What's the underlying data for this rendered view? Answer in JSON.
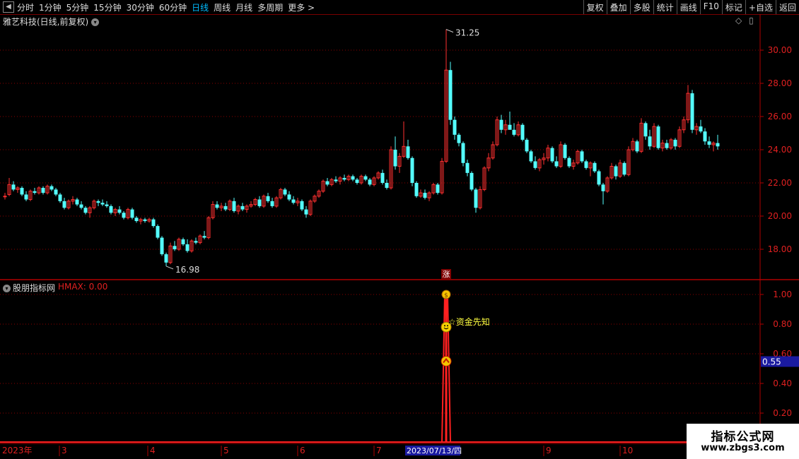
{
  "toolbar": {
    "timeframes": [
      "分时",
      "1分钟",
      "5分钟",
      "15分钟",
      "30分钟",
      "60分钟",
      "日线",
      "周线",
      "月线",
      "多周期",
      "更多"
    ],
    "active": "日线",
    "right_buttons": [
      "复权",
      "叠加",
      "多股",
      "统计",
      "画线",
      "F10",
      "标记",
      "+自选",
      "返回"
    ]
  },
  "main": {
    "title": "雅艺科技(日线,前复权)",
    "price_max_label": "31.25",
    "price_min_label": "16.98",
    "y_ticks": [
      "30.00",
      "28.00",
      "26.00",
      "24.00",
      "22.00",
      "20.00",
      "18.00"
    ],
    "marker": "涨"
  },
  "indicator": {
    "title": "股朋指标网",
    "value_label": "HMAX: 0.00",
    "y_ticks": [
      "1.00",
      "0.80",
      "0.60",
      "0.40",
      "0.20"
    ],
    "current_value": "0.55",
    "annotation": "资金先知"
  },
  "xaxis": {
    "year": "2023年",
    "months": [
      "3",
      "4",
      "5",
      "6",
      "7",
      "9",
      "10"
    ],
    "cursor_date": "2023/07/13/四"
  },
  "watermark": {
    "line1": "指标公式网",
    "line2": "www.zbgs3.com"
  },
  "colors": {
    "up": "#ff3030",
    "down": "#54ffff",
    "grid": "#8b0000",
    "axis": "#b00000",
    "label": "#e02020"
  },
  "chart_data": {
    "type": "candlestick",
    "ylim": [
      16.2,
      32.0
    ],
    "ohlc": [
      [
        21.2,
        21.4,
        21.0,
        21.2
      ],
      [
        21.3,
        22.3,
        21.2,
        21.9
      ],
      [
        21.9,
        22.1,
        21.5,
        21.6
      ],
      [
        21.6,
        21.8,
        21.4,
        21.7
      ],
      [
        21.7,
        21.8,
        21.2,
        21.3
      ],
      [
        21.3,
        21.5,
        20.9,
        21.0
      ],
      [
        21.0,
        21.6,
        20.9,
        21.5
      ],
      [
        21.5,
        21.7,
        21.3,
        21.4
      ],
      [
        21.4,
        21.8,
        21.3,
        21.7
      ],
      [
        21.7,
        21.8,
        21.3,
        21.4
      ],
      [
        21.4,
        21.9,
        21.3,
        21.8
      ],
      [
        21.8,
        21.9,
        21.5,
        21.6
      ],
      [
        21.6,
        21.7,
        21.2,
        21.3
      ],
      [
        21.3,
        21.4,
        20.8,
        20.9
      ],
      [
        20.9,
        21.1,
        20.4,
        20.5
      ],
      [
        20.5,
        21.0,
        20.4,
        20.9
      ],
      [
        20.9,
        21.2,
        20.7,
        21.0
      ],
      [
        21.0,
        21.1,
        20.6,
        20.7
      ],
      [
        20.7,
        20.9,
        20.4,
        20.5
      ],
      [
        20.5,
        20.6,
        20.1,
        20.2
      ],
      [
        20.2,
        20.6,
        19.9,
        20.5
      ],
      [
        20.5,
        21.0,
        20.4,
        20.9
      ],
      [
        20.9,
        21.0,
        20.6,
        20.8
      ],
      [
        20.8,
        21.0,
        20.6,
        20.7
      ],
      [
        20.7,
        20.9,
        20.5,
        20.6
      ],
      [
        20.6,
        20.7,
        20.1,
        20.2
      ],
      [
        20.2,
        20.5,
        20.0,
        20.4
      ],
      [
        20.4,
        20.6,
        20.1,
        20.2
      ],
      [
        20.2,
        20.3,
        19.8,
        19.9
      ],
      [
        19.9,
        20.5,
        19.8,
        20.4
      ],
      [
        20.4,
        20.5,
        19.8,
        19.9
      ],
      [
        19.9,
        20.0,
        19.6,
        19.7
      ],
      [
        19.7,
        19.9,
        19.5,
        19.8
      ],
      [
        19.8,
        19.9,
        19.6,
        19.7
      ],
      [
        19.7,
        19.9,
        19.6,
        19.8
      ],
      [
        19.8,
        19.9,
        19.3,
        19.4
      ],
      [
        19.4,
        19.5,
        18.6,
        18.7
      ],
      [
        18.7,
        18.8,
        17.6,
        17.7
      ],
      [
        17.7,
        17.8,
        16.98,
        17.2
      ],
      [
        17.2,
        18.4,
        17.1,
        18.2
      ],
      [
        18.2,
        18.5,
        17.9,
        18.0
      ],
      [
        18.0,
        18.7,
        17.9,
        18.6
      ],
      [
        18.6,
        18.7,
        18.2,
        18.3
      ],
      [
        18.3,
        18.6,
        17.8,
        17.9
      ],
      [
        17.9,
        18.6,
        17.8,
        18.5
      ],
      [
        18.5,
        18.7,
        18.3,
        18.4
      ],
      [
        18.4,
        18.9,
        18.3,
        18.8
      ],
      [
        18.8,
        19.1,
        18.6,
        18.7
      ],
      [
        18.7,
        20.0,
        18.6,
        19.9
      ],
      [
        19.9,
        20.9,
        19.8,
        20.7
      ],
      [
        20.7,
        20.9,
        20.4,
        20.5
      ],
      [
        20.5,
        20.8,
        20.3,
        20.6
      ],
      [
        20.6,
        20.8,
        20.3,
        20.4
      ],
      [
        20.4,
        21.0,
        20.3,
        20.9
      ],
      [
        20.9,
        21.1,
        20.2,
        20.3
      ],
      [
        20.3,
        20.7,
        20.1,
        20.6
      ],
      [
        20.6,
        20.8,
        20.3,
        20.4
      ],
      [
        20.4,
        20.7,
        20.2,
        20.6
      ],
      [
        20.6,
        20.9,
        20.5,
        20.7
      ],
      [
        20.7,
        21.1,
        20.6,
        21.0
      ],
      [
        21.0,
        21.2,
        20.5,
        20.6
      ],
      [
        20.6,
        21.3,
        20.5,
        21.2
      ],
      [
        21.2,
        21.4,
        20.8,
        20.9
      ],
      [
        20.9,
        21.1,
        20.5,
        20.6
      ],
      [
        20.6,
        21.2,
        20.5,
        21.1
      ],
      [
        21.1,
        21.7,
        21.0,
        21.6
      ],
      [
        21.6,
        21.7,
        21.2,
        21.3
      ],
      [
        21.3,
        21.5,
        20.9,
        21.0
      ],
      [
        21.0,
        21.2,
        20.7,
        20.8
      ],
      [
        20.8,
        21.1,
        20.6,
        20.9
      ],
      [
        20.9,
        21.0,
        20.3,
        20.4
      ],
      [
        20.4,
        20.6,
        19.9,
        20.1
      ],
      [
        20.1,
        21.0,
        20.0,
        20.9
      ],
      [
        20.9,
        21.3,
        20.8,
        21.2
      ],
      [
        21.2,
        21.6,
        21.1,
        21.5
      ],
      [
        21.5,
        22.2,
        21.4,
        22.1
      ],
      [
        22.1,
        22.3,
        21.8,
        21.9
      ],
      [
        21.9,
        22.3,
        21.8,
        22.2
      ],
      [
        22.2,
        22.4,
        22.0,
        22.1
      ],
      [
        22.1,
        22.4,
        21.9,
        22.3
      ],
      [
        22.3,
        22.5,
        22.1,
        22.2
      ],
      [
        22.2,
        22.5,
        22.1,
        22.4
      ],
      [
        22.4,
        22.5,
        22.1,
        22.2
      ],
      [
        22.2,
        22.3,
        21.9,
        22.0
      ],
      [
        22.0,
        22.5,
        21.9,
        22.4
      ],
      [
        22.4,
        22.5,
        22.1,
        22.2
      ],
      [
        22.2,
        22.3,
        21.8,
        21.9
      ],
      [
        21.9,
        22.4,
        21.8,
        22.3
      ],
      [
        22.3,
        22.7,
        22.2,
        22.6
      ],
      [
        22.6,
        22.8,
        21.9,
        22.0
      ],
      [
        22.0,
        22.2,
        21.6,
        21.7
      ],
      [
        21.7,
        24.2,
        21.6,
        24.0
      ],
      [
        24.0,
        24.8,
        22.8,
        23.0
      ],
      [
        23.0,
        23.8,
        22.6,
        23.6
      ],
      [
        23.6,
        25.7,
        23.5,
        24.2
      ],
      [
        24.2,
        24.6,
        23.4,
        23.5
      ],
      [
        23.5,
        23.6,
        21.8,
        22.0
      ],
      [
        22.0,
        22.1,
        21.1,
        21.2
      ],
      [
        21.2,
        21.6,
        21.1,
        21.4
      ],
      [
        21.4,
        21.6,
        21.0,
        21.1
      ],
      [
        21.1,
        21.5,
        20.9,
        21.4
      ],
      [
        21.4,
        22.0,
        21.3,
        21.9
      ],
      [
        21.9,
        22.0,
        21.3,
        21.4
      ],
      [
        21.4,
        23.5,
        21.3,
        23.3
      ],
      [
        23.3,
        31.25,
        23.2,
        28.8
      ],
      [
        28.8,
        29.3,
        25.5,
        25.8
      ],
      [
        25.8,
        26.0,
        24.6,
        24.9
      ],
      [
        24.9,
        25.0,
        24.2,
        24.4
      ],
      [
        24.4,
        24.5,
        23.0,
        23.2
      ],
      [
        23.2,
        23.4,
        22.4,
        22.6
      ],
      [
        22.6,
        22.7,
        21.5,
        21.6
      ],
      [
        21.6,
        21.7,
        20.2,
        20.5
      ],
      [
        20.5,
        21.8,
        20.4,
        21.6
      ],
      [
        21.6,
        23.0,
        21.5,
        22.9
      ],
      [
        22.9,
        23.8,
        22.7,
        23.5
      ],
      [
        23.5,
        24.5,
        23.4,
        24.3
      ],
      [
        24.3,
        26.0,
        24.2,
        25.8
      ],
      [
        25.8,
        26.1,
        25.0,
        25.2
      ],
      [
        25.2,
        25.8,
        24.9,
        25.5
      ],
      [
        25.5,
        26.3,
        25.4,
        25.2
      ],
      [
        25.2,
        25.6,
        24.8,
        24.9
      ],
      [
        24.9,
        25.7,
        24.8,
        25.5
      ],
      [
        25.5,
        25.6,
        24.5,
        24.6
      ],
      [
        24.6,
        24.7,
        23.8,
        23.9
      ],
      [
        23.9,
        24.0,
        23.2,
        23.3
      ],
      [
        23.3,
        23.6,
        22.8,
        22.9
      ],
      [
        22.9,
        23.5,
        22.7,
        23.4
      ],
      [
        23.4,
        23.8,
        23.1,
        23.5
      ],
      [
        23.5,
        24.3,
        23.3,
        24.1
      ],
      [
        24.1,
        24.2,
        23.2,
        23.3
      ],
      [
        23.3,
        23.6,
        22.9,
        23.0
      ],
      [
        23.0,
        24.5,
        22.9,
        24.3
      ],
      [
        24.3,
        24.4,
        23.4,
        23.5
      ],
      [
        23.5,
        23.6,
        22.9,
        23.0
      ],
      [
        23.0,
        23.4,
        22.8,
        23.2
      ],
      [
        23.2,
        24.0,
        23.1,
        23.9
      ],
      [
        23.9,
        24.0,
        23.2,
        23.3
      ],
      [
        23.3,
        23.4,
        22.8,
        22.9
      ],
      [
        22.9,
        23.3,
        22.4,
        23.2
      ],
      [
        23.2,
        23.3,
        22.6,
        22.7
      ],
      [
        22.7,
        22.8,
        21.8,
        21.9
      ],
      [
        21.9,
        22.0,
        20.7,
        21.5
      ],
      [
        21.5,
        22.4,
        21.4,
        22.3
      ],
      [
        22.3,
        23.2,
        22.2,
        23.0
      ],
      [
        23.0,
        23.1,
        22.2,
        22.4
      ],
      [
        22.4,
        23.4,
        22.3,
        23.2
      ],
      [
        23.2,
        23.3,
        22.4,
        22.5
      ],
      [
        22.5,
        24.2,
        22.4,
        24.0
      ],
      [
        24.0,
        24.7,
        23.9,
        24.5
      ],
      [
        24.5,
        24.6,
        23.8,
        23.9
      ],
      [
        23.9,
        25.9,
        23.8,
        25.6
      ],
      [
        25.6,
        25.7,
        24.6,
        24.8
      ],
      [
        24.8,
        25.2,
        24.0,
        24.2
      ],
      [
        24.2,
        25.6,
        24.1,
        25.4
      ],
      [
        25.4,
        25.5,
        24.0,
        24.1
      ],
      [
        24.1,
        24.6,
        23.9,
        24.4
      ],
      [
        24.4,
        24.6,
        24.0,
        24.1
      ],
      [
        24.1,
        24.7,
        24.0,
        24.6
      ],
      [
        24.6,
        24.7,
        24.0,
        24.2
      ],
      [
        24.2,
        25.4,
        24.1,
        25.2
      ],
      [
        25.2,
        26.0,
        25.0,
        25.8
      ],
      [
        25.8,
        27.9,
        25.6,
        27.4
      ],
      [
        27.4,
        27.6,
        25.0,
        25.2
      ],
      [
        25.2,
        25.6,
        24.9,
        25.4
      ],
      [
        25.4,
        25.8,
        25.0,
        25.1
      ],
      [
        25.1,
        25.3,
        24.3,
        24.5
      ],
      [
        24.5,
        24.8,
        24.1,
        24.3
      ],
      [
        24.3,
        24.5,
        23.9,
        24.4
      ],
      [
        24.4,
        24.9,
        24.0,
        24.2
      ]
    ],
    "indicator_series": {
      "name": "HMAX",
      "spike_index": 104,
      "spike_value": 1.0,
      "signal_levels": [
        1.0,
        0.78,
        0.55
      ],
      "ylim": [
        0,
        1.1
      ]
    }
  }
}
